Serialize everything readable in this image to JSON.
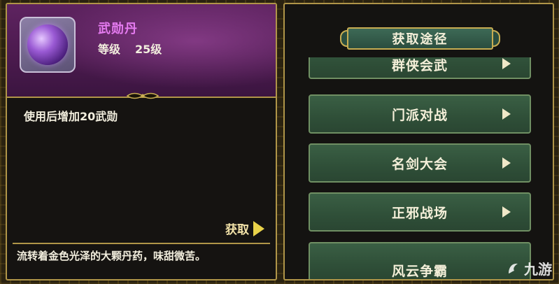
{
  "item": {
    "name": "武勋丹",
    "level_label": "等级",
    "level_value": "25级",
    "effect": "使用后增加20武勋",
    "obtain_label": "获取",
    "description": "流转着金色光泽的大颗丹药，味甜微苦。"
  },
  "routes_panel": {
    "title": "获取途径",
    "routes": [
      {
        "label": "群侠会武"
      },
      {
        "label": "门派对战"
      },
      {
        "label": "名剑大会"
      },
      {
        "label": "正邪战场"
      },
      {
        "label": "风云争霸"
      }
    ]
  },
  "watermark": {
    "text": "九游"
  },
  "colors": {
    "panel_border": "#b09548",
    "item_name": "#e57bf0",
    "route_button": "#3a5f44",
    "arrow": "#e9d24a"
  }
}
